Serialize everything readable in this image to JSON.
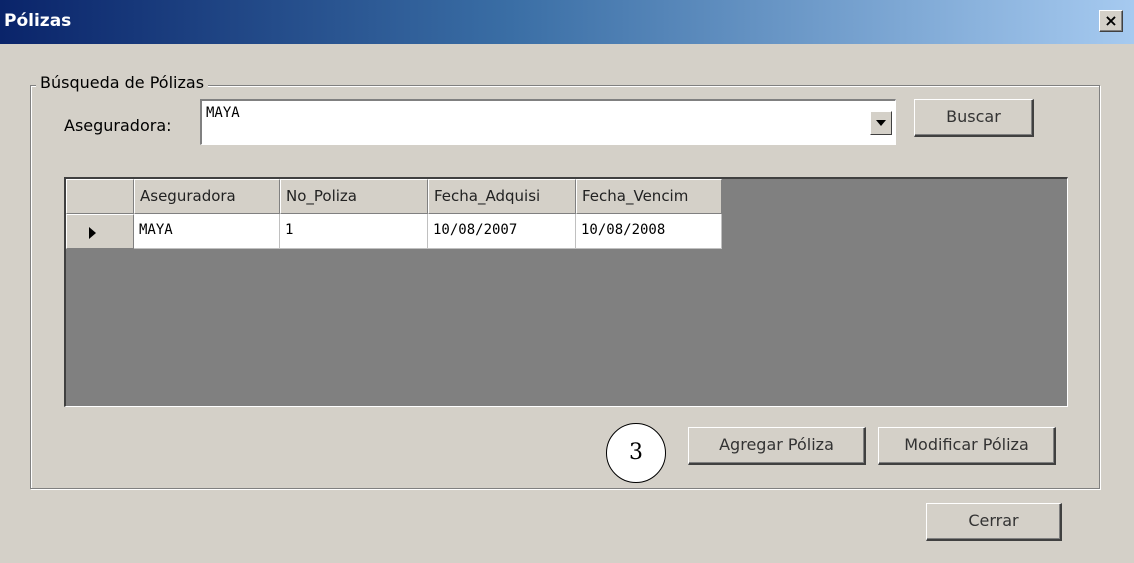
{
  "window": {
    "title": "Pólizas",
    "close_glyph": "×"
  },
  "search_group": {
    "legend": "Búsqueda de Pólizas",
    "aseguradora_label": "Aseguradora:",
    "aseguradora_value": "MAYA",
    "buscar_label": "Buscar"
  },
  "grid": {
    "columns": [
      "Aseguradora",
      "No_Poliza",
      "Fecha_Adquisi",
      "Fecha_Vencim"
    ],
    "rows": [
      {
        "cells": [
          "MAYA",
          "1",
          "10/08/2007",
          "10/08/2008"
        ]
      }
    ]
  },
  "actions": {
    "annotation": "3",
    "agregar_label": "Agregar Póliza",
    "modificar_label": "Modificar Póliza",
    "cerrar_label": "Cerrar"
  },
  "colors": {
    "window_bg": "#d4d0c8",
    "title_bar_start": "#0a246a",
    "title_bar_end": "#a6caf0",
    "grid_bg": "#808080",
    "cell_bg": "#ffffff"
  },
  "icons": {
    "close": "close-icon",
    "dropdown": "chevron-down-icon",
    "row_indicator": "row-pointer-icon"
  }
}
